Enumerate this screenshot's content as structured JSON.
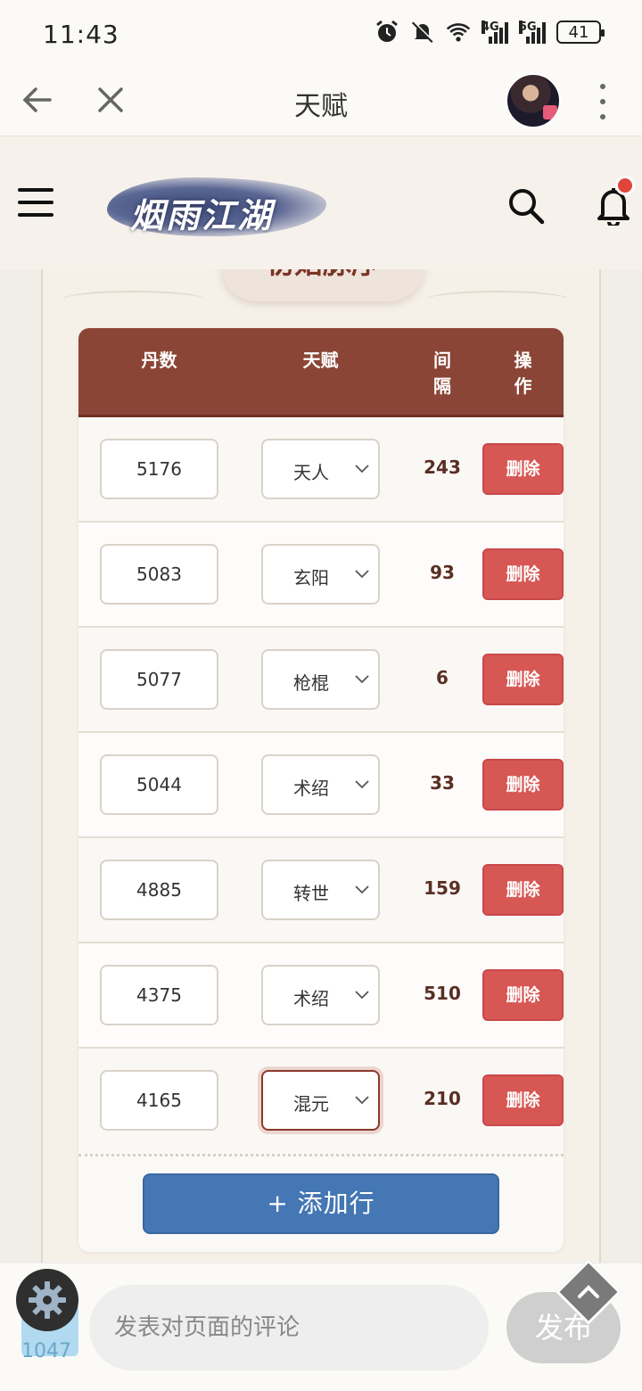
{
  "status_bar": {
    "time": "11:43",
    "net1": "4G",
    "net2": "5G",
    "battery": "41"
  },
  "topbar": {
    "title": "天赋"
  },
  "site": {
    "logo_text": "烟雨江湖"
  },
  "section": {
    "title": "初始脉序"
  },
  "table": {
    "headers": {
      "dan": "丹数",
      "talent": "天赋",
      "interval": "间\n隔",
      "action": "操\n作"
    },
    "rows": [
      {
        "dan": "5176",
        "talent": "天人",
        "interval": "243",
        "action": "删除"
      },
      {
        "dan": "5083",
        "talent": "玄阳",
        "interval": "93",
        "action": "删除"
      },
      {
        "dan": "5077",
        "talent": "枪棍",
        "interval": "6",
        "action": "删除"
      },
      {
        "dan": "5044",
        "talent": "术绍",
        "interval": "33",
        "action": "删除"
      },
      {
        "dan": "4885",
        "talent": "转世",
        "interval": "159",
        "action": "删除"
      },
      {
        "dan": "4375",
        "talent": "术绍",
        "interval": "510",
        "action": "删除"
      },
      {
        "dan": "4165",
        "talent": "混元",
        "interval": "210",
        "action": "删除"
      }
    ],
    "add_row_label": "+ 添加行"
  },
  "comment_bar": {
    "placeholder": "发表对页面的评论",
    "publish": "发布",
    "badge": "1047"
  }
}
